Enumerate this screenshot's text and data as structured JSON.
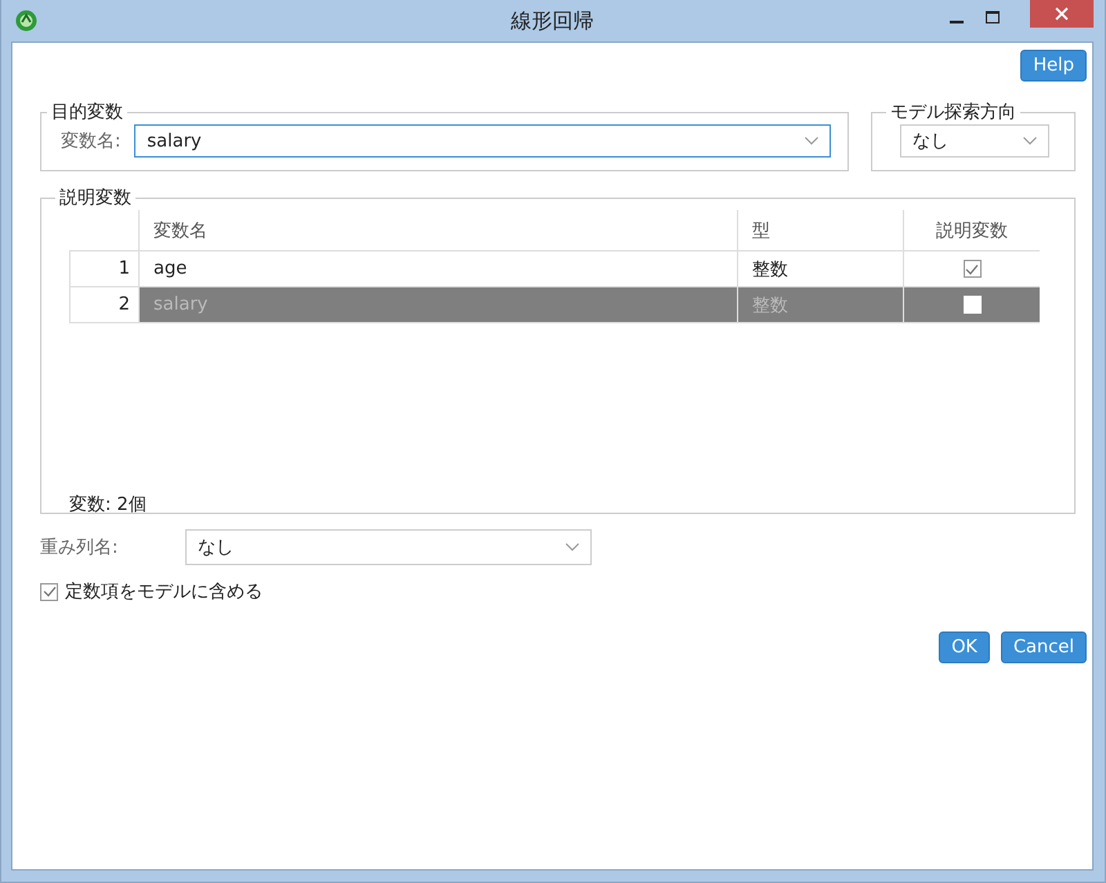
{
  "window": {
    "title": "線形回帰"
  },
  "help_button": "Help",
  "target_group": {
    "title": "目的変数",
    "label": "変数名:",
    "value": "salary"
  },
  "direction_group": {
    "title": "モデル探索方向",
    "value": "なし"
  },
  "explanatory_group": {
    "title": "説明変数",
    "columns": [
      "変数名",
      "型",
      "説明変数"
    ],
    "rows": [
      {
        "index": "1",
        "name": "age",
        "type": "整数",
        "checked": true,
        "selected": false
      },
      {
        "index": "2",
        "name": "salary",
        "type": "整数",
        "checked": false,
        "selected": true
      }
    ],
    "count": "変数: 2個"
  },
  "weight": {
    "label": "重み列名:",
    "value": "なし"
  },
  "intercept": {
    "label": "定数項をモデルに含める",
    "checked": true
  },
  "buttons": [
    "OK",
    "Cancel"
  ]
}
